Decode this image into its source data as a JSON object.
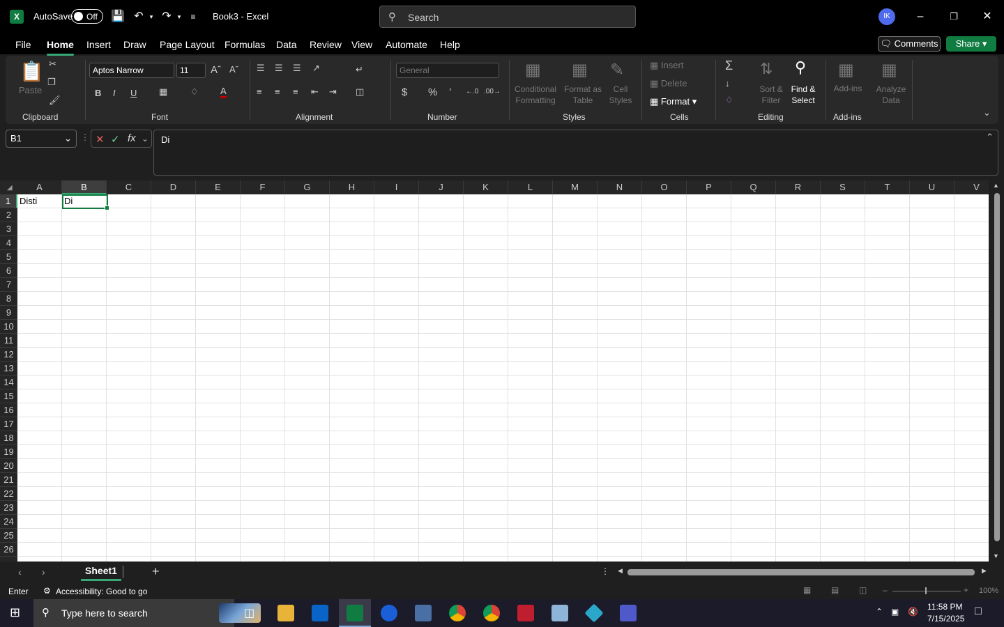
{
  "titlebar": {
    "autosave_label": "AutoSave",
    "autosave_state": "Off",
    "doc_title": "Book3  -  Excel",
    "search_placeholder": "Search",
    "avatar_initials": "IK"
  },
  "menu": {
    "tabs": [
      "File",
      "Home",
      "Insert",
      "Draw",
      "Page Layout",
      "Formulas",
      "Data",
      "Review",
      "View",
      "Automate",
      "Help"
    ],
    "active_tab": "Home",
    "comments_label": "Comments",
    "share_label": "Share"
  },
  "ribbon": {
    "clipboard": {
      "label": "Clipboard",
      "paste": "Paste"
    },
    "font": {
      "label": "Font",
      "font_name": "Aptos Narrow",
      "font_size": "11",
      "bold": "B",
      "italic": "I",
      "underline": "U"
    },
    "alignment": {
      "label": "Alignment"
    },
    "number": {
      "label": "Number",
      "format": "General"
    },
    "styles": {
      "label": "Styles",
      "conditional": "Conditional Formatting",
      "format_table": "Format as Table",
      "cell_styles": "Cell Styles"
    },
    "cells": {
      "label": "Cells",
      "insert": "Insert",
      "delete": "Delete",
      "format": "Format"
    },
    "editing": {
      "label": "Editing",
      "sort_filter": "Sort & Filter",
      "find_select": "Find & Select"
    },
    "addins": {
      "label": "Add-ins",
      "addins_btn": "Add-ins",
      "analyze": "Analyze Data"
    }
  },
  "formula_bar": {
    "name_box": "B1",
    "content": "Di"
  },
  "grid": {
    "columns": [
      "A",
      "B",
      "C",
      "D",
      "E",
      "F",
      "G",
      "H",
      "I",
      "J",
      "K",
      "L",
      "M",
      "N",
      "O",
      "P",
      "Q",
      "R",
      "S",
      "T",
      "U",
      "V"
    ],
    "rows": [
      "1",
      "2",
      "3",
      "4",
      "5",
      "6",
      "7",
      "8",
      "9",
      "10",
      "11",
      "12",
      "13",
      "14",
      "15",
      "16",
      "17",
      "18",
      "19",
      "20",
      "21",
      "22",
      "23",
      "24",
      "25",
      "26"
    ],
    "selected_column": "B",
    "selected_row": "1",
    "cells": {
      "A1": "Disti",
      "B1": "Di"
    }
  },
  "sheets": {
    "tabs": [
      "Sheet1"
    ],
    "active": "Sheet1"
  },
  "status": {
    "mode": "Enter",
    "accessibility": "Accessibility: Good to go",
    "zoom": "100%"
  },
  "taskbar": {
    "search_placeholder": "Type here to search",
    "time": "11:58 PM",
    "date": "7/15/2025"
  }
}
